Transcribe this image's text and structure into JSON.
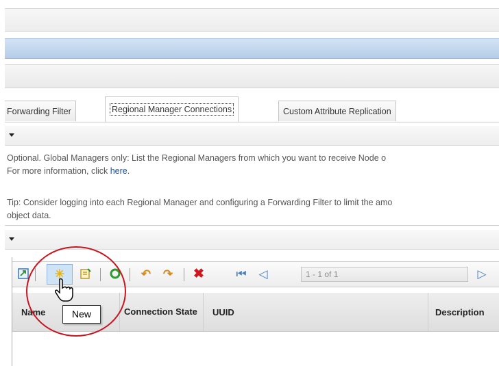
{
  "tabs": [
    {
      "label": "Forwarding Filter",
      "active": false
    },
    {
      "label": "Regional Manager Connections",
      "active": true
    },
    {
      "label": "Custom Attribute Replication",
      "active": false
    }
  ],
  "info": {
    "line1": "Optional. Global Managers only: List the Regional Managers from which you want to receive Node o",
    "line2_prefix": "For more information, click ",
    "line2_link": "here",
    "line2_suffix": ".",
    "tip1": "Tip: Consider logging into each Regional Manager and configuring a Forwarding Filter to limit the amo",
    "tip2": "object data."
  },
  "toolbar": {
    "open_icon": "open-icon",
    "new_icon": "new-asterisk-icon",
    "open_form_icon": "open-form-icon",
    "refresh_icon": "refresh-icon",
    "undo_icon": "undo-icon",
    "redo_icon": "redo-icon",
    "delete_icon": "delete-icon",
    "first_page_icon": "first-page-icon",
    "prev_page_icon": "previous-page-icon",
    "paging_text": "1 - 1 of 1",
    "next_page_icon": "next-page-icon"
  },
  "table": {
    "columns": [
      "Name",
      "Connection State",
      "UUID",
      "Description"
    ],
    "rows": []
  },
  "tooltip": {
    "text": "New"
  },
  "colors": {
    "highlight_circle": "#c8141e",
    "link": "#1f4fa3",
    "active_tab_border": "#b8c7d8"
  }
}
